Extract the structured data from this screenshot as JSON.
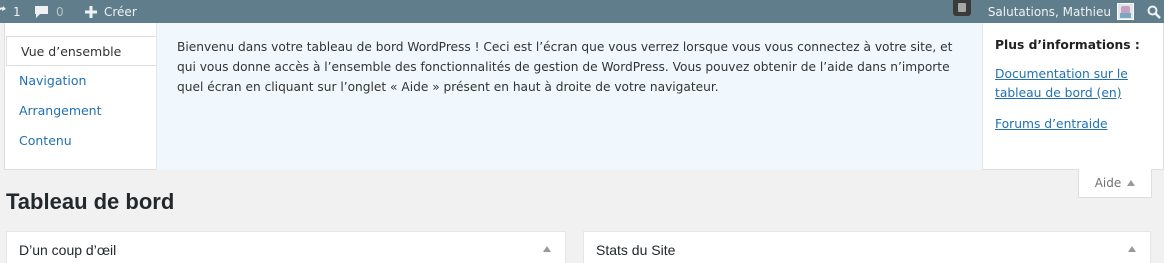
{
  "adminbar": {
    "updates_count": "1",
    "comments_count": "0",
    "new_label": "Créer",
    "greeting": "Salutations, Mathieu",
    "colors": {
      "bar": "#607d8b",
      "text": "#eef2f4"
    },
    "icons": {
      "updates": "refresh-icon",
      "comments": "comment-icon",
      "new": "plus-icon",
      "screen": "screen-options-icon",
      "search": "search-icon"
    }
  },
  "help": {
    "tabs": [
      {
        "label": "Vue d’ensemble",
        "active": true
      },
      {
        "label": "Navigation",
        "active": false
      },
      {
        "label": "Arrangement",
        "active": false
      },
      {
        "label": "Contenu",
        "active": false
      }
    ],
    "content_lines": [
      "Bienvenu dans votre tableau de bord WordPress ! Ceci est l’écran que vous verrez lorsque vous vous connectez à votre site, et",
      "qui vous donne accès à l’ensemble des fonctionnalités de gestion de WordPress. Vous pouvez obtenir de l’aide dans n’importe",
      "quel écran en cliquant sur l’onglet « Aide » présent en haut à droite de votre navigateur."
    ],
    "sidebar_title": "Plus d’informations :",
    "links": [
      {
        "line1": "Documentation sur le",
        "line2": "tableau de bord (en)"
      },
      {
        "line1": "Forums d’entraide"
      }
    ],
    "toggle_label": "Aide",
    "link_color": "#2271b1",
    "content_bg": "#f0f8fd"
  },
  "page": {
    "title": "Tableau de bord"
  },
  "widgets": [
    {
      "title": "D’un coup d’œil"
    },
    {
      "title": "Stats du Site"
    }
  ]
}
